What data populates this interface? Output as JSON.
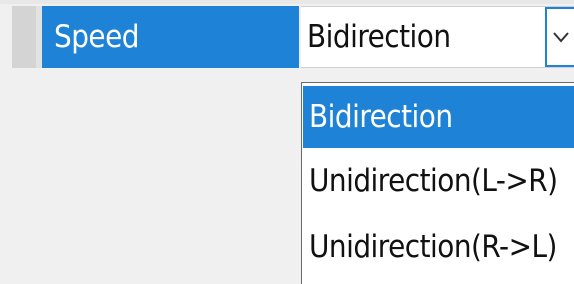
{
  "property_grid": {
    "row": {
      "label": "Speed",
      "value": "Bidirection"
    }
  },
  "dropdown": {
    "selected_index": 0,
    "options": [
      "Bidirection",
      "Unidirection(L->R)",
      "Unidirection(R->L)"
    ]
  },
  "icons": {
    "combo_button": "chevron-down-icon"
  },
  "colors": {
    "selection": "#1e82d6",
    "selection_text": "#ffffff",
    "text": "#111111",
    "background": "#f0f0f0"
  }
}
